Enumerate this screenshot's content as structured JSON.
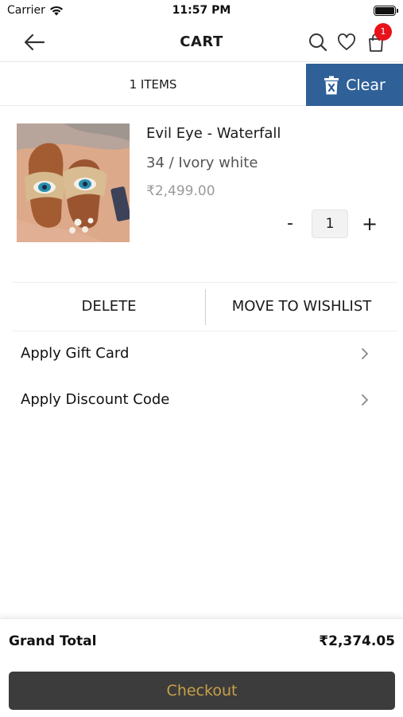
{
  "status_bar": {
    "carrier": "Carrier",
    "time": "11:57 PM"
  },
  "nav": {
    "title": "CART",
    "back_icon": "arrow-left-icon",
    "search_icon": "search-icon",
    "wishlist_icon": "heart-icon",
    "bag_icon": "shopping-bag-icon",
    "bag_badge": "1"
  },
  "cart_header": {
    "items_count": "1 ITEMS",
    "clear_label": "Clear",
    "clear_icon": "trash-icon"
  },
  "cart_items": [
    {
      "name": "Evil Eye - Waterfall",
      "variant": "34 / Ivory white",
      "price": "₹2,499.00",
      "quantity": "1",
      "decrement_label": "-",
      "increment_label": "+"
    }
  ],
  "item_actions": {
    "delete_label": "DELETE",
    "wishlist_label": "MOVE TO WISHLIST"
  },
  "options": {
    "gift_card_label": "Apply Gift Card",
    "discount_label": "Apply Discount Code"
  },
  "footer": {
    "total_label": "Grand Total",
    "total_value": "₹2,374.05",
    "checkout_label": "Checkout"
  },
  "colors": {
    "accent_blue": "#2f6097",
    "badge_red": "#e8121a",
    "checkout_bg": "#3c3c3c",
    "checkout_text": "#c8a046"
  }
}
